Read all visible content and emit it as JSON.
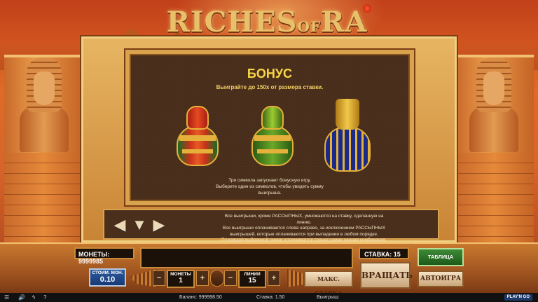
{
  "game": {
    "title_part1": "RICHES",
    "title_part2": "OF",
    "title_part3": "RA"
  },
  "panel": {
    "title": "БОНУС",
    "subtitle": "Выиграйте до 150x от размера ставки.",
    "rules_line1": "Три символа запускают бонусную игру.",
    "rules_line2": "Выберите один из символов, чтобы увидеть сумму",
    "rules_line3": "выигрыша."
  },
  "info_strip": {
    "line1": "Все выигрыши, кроме РАССЫПНЫХ, умножаются на ставку, сделанную на",
    "line2": "линию.",
    "line3": "Все выигрыши оплачиваются слева направо, за исключением РАССЫПНЫХ",
    "line4": "выигрышей, которые оплачиваются при выпадении в любом порядке.",
    "line5": "По каждой выбранной линии оплачивается только самая ценная комбинация."
  },
  "controls": {
    "coins_label": "МОНЕТЫ: 9999985",
    "bet_label": "СТАВКА: 15",
    "stake_label": "СТОИМ. МОН.",
    "stake_value": "0.10",
    "coins_ctrl_label": "МОНЕТЫ",
    "coins_ctrl_value": "1",
    "lines_label": "ЛИНИИ",
    "lines_value": "15",
    "max_bet": "МАКС. СТАВКА",
    "spin": "ВРАЩАТЬ",
    "autoplay": "АВТОИГРА",
    "paytable": "ТАБЛИЦА ВЫПЛАТ",
    "minus": "−",
    "plus": "+"
  },
  "bottom_bar": {
    "balance": "Баланс: 999998.50",
    "bet": "Ставка: 1.50",
    "win": "Выигрыш:",
    "logo": "PLAY'N GO"
  },
  "icons": {
    "menu": "☰",
    "sound": "🔊",
    "lightning": "ϟ",
    "question": "?",
    "arrow_left": "◀",
    "arrow_down": "▼",
    "arrow_right": "▶"
  }
}
